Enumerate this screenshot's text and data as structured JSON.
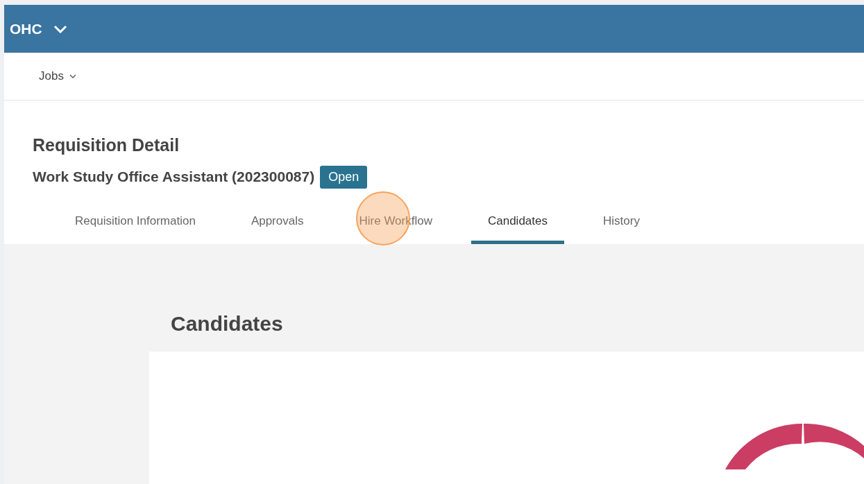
{
  "top_bar": {
    "title": "OHC"
  },
  "nav": {
    "items": [
      {
        "label": "Jobs"
      }
    ]
  },
  "header": {
    "title": "Requisition Detail",
    "subtitle": "Work Study Office Assistant (202300087)",
    "status_badge": "Open"
  },
  "tabs": [
    {
      "label": "Requisition Information",
      "selected": false
    },
    {
      "label": "Approvals",
      "selected": false
    },
    {
      "label": "Hire Workflow",
      "selected": false,
      "click_marker": true
    },
    {
      "label": "Candidates",
      "selected": true
    },
    {
      "label": "History",
      "selected": false
    }
  ],
  "section": {
    "title": "Candidates"
  }
}
